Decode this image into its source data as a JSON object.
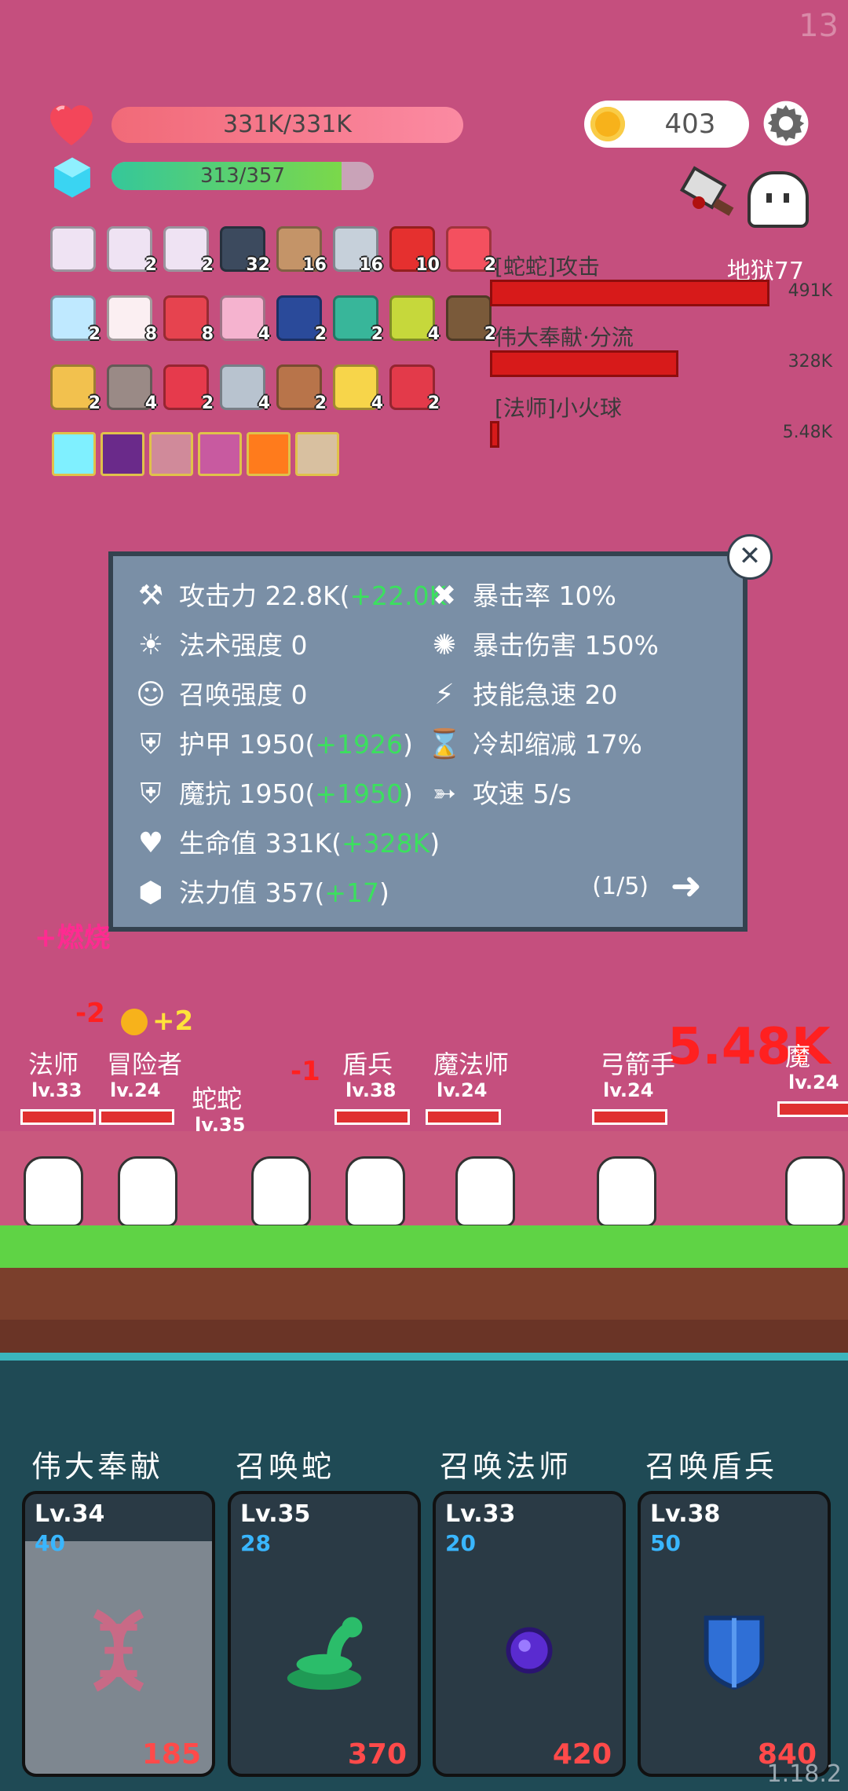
{
  "corner_number": "13",
  "hp": {
    "text": "331K/331K",
    "fraction": 1.0
  },
  "mana": {
    "text": "313/357",
    "fraction": 0.877
  },
  "coins": "403",
  "items": [
    {
      "icon": "scroll-icon",
      "count": ""
    },
    {
      "icon": "scroll-icon",
      "count": "2"
    },
    {
      "icon": "scroll-icon",
      "count": "2"
    },
    {
      "icon": "book-icon",
      "count": "32"
    },
    {
      "icon": "shield-round-icon",
      "count": "16"
    },
    {
      "icon": "sword-icon",
      "count": "16"
    },
    {
      "icon": "apple-icon",
      "count": "10"
    },
    {
      "icon": "heart-icon",
      "count": "2"
    },
    {
      "icon": "magnifier-icon",
      "count": "2"
    },
    {
      "icon": "flower-icon",
      "count": "8"
    },
    {
      "icon": "watermelon-icon",
      "count": "8"
    },
    {
      "icon": "icecream-icon",
      "count": "4"
    },
    {
      "icon": "bible-icon",
      "count": "2"
    },
    {
      "icon": "tent-icon",
      "count": "2"
    },
    {
      "icon": "durian-icon",
      "count": "4"
    },
    {
      "icon": "coconut-icon",
      "count": "2"
    },
    {
      "icon": "gift-icon",
      "count": "2"
    },
    {
      "icon": "tombstone-icon",
      "count": "4"
    },
    {
      "icon": "bookmark-icon",
      "count": "2"
    },
    {
      "icon": "mace-icon",
      "count": "4"
    },
    {
      "icon": "meat-icon",
      "count": "2"
    },
    {
      "icon": "cheese-icon",
      "count": "4"
    },
    {
      "icon": "strawberry-icon",
      "count": "2"
    }
  ],
  "skills": [
    "light-skill-icon",
    "demon-skill-icon",
    "blade-skill-icon",
    "pink-skill-icon",
    "fire-skill-icon",
    "shield-skill-icon"
  ],
  "damage_panel": {
    "difficulty": "地狱77",
    "rows": [
      {
        "name": "[蛇蛇]攻击",
        "value": "491K",
        "fraction": 1.0
      },
      {
        "name": "伟大奉献·分流",
        "value": "328K",
        "fraction": 0.668
      },
      {
        "name": "[法师]小火球",
        "value": "5.48K",
        "fraction": 0.011
      }
    ]
  },
  "stats": {
    "left": [
      {
        "icon": "axe-icon",
        "label": "攻击力",
        "value": "22.8K(",
        "bonus": "+22.0K",
        "tail": ""
      },
      {
        "icon": "sun-icon",
        "label": "法术强度",
        "value": "0",
        "bonus": "",
        "tail": ""
      },
      {
        "icon": "summon-icon",
        "label": "召唤强度",
        "value": "0",
        "bonus": "",
        "tail": ""
      },
      {
        "icon": "shield-icon",
        "label": "护甲",
        "value": "1950(",
        "bonus": "+1926",
        "tail": ")"
      },
      {
        "icon": "magic-shield-icon",
        "label": "魔抗",
        "value": "1950(",
        "bonus": "+1950",
        "tail": ")"
      },
      {
        "icon": "heart-icon",
        "label": "生命值",
        "value": "331K(",
        "bonus": "+328K",
        "tail": ")"
      },
      {
        "icon": "crystal-icon",
        "label": "法力值",
        "value": "357(",
        "bonus": "+17",
        "tail": ")"
      }
    ],
    "right": [
      {
        "icon": "crit-icon",
        "label": "暴击率",
        "value": "10%"
      },
      {
        "icon": "crit-damage-icon",
        "label": "暴击伤害",
        "value": "150%"
      },
      {
        "icon": "lightning-icon",
        "label": "技能急速",
        "value": "20"
      },
      {
        "icon": "hourglass-icon",
        "label": "冷却缩减",
        "value": "17%"
      },
      {
        "icon": "bow-icon",
        "label": "攻速",
        "value": "5/s"
      }
    ],
    "page": "(1/5)"
  },
  "battle": {
    "burn_text": "+燃烧",
    "big_damage": "5.48K",
    "coin_gain": "+2",
    "damage_pops": [
      "-2",
      "-1"
    ],
    "units": [
      {
        "name": "法师",
        "lv": "lv.33"
      },
      {
        "name": "冒险者",
        "lv": "lv.24"
      },
      {
        "name": "蛇蛇",
        "lv": "lv.35"
      },
      {
        "name": "盾兵",
        "lv": "lv.38"
      },
      {
        "name": "魔法师",
        "lv": "lv.24"
      },
      {
        "name": "弓箭手",
        "lv": "lv.24"
      },
      {
        "name": "魔",
        "lv": "lv.24"
      }
    ]
  },
  "cards": [
    {
      "title": "伟大奉献",
      "lv": "Lv.34",
      "cost": "40",
      "price": "185",
      "icon": "dna-icon"
    },
    {
      "title": "召唤蛇",
      "lv": "Lv.35",
      "cost": "28",
      "price": "370",
      "icon": "snake-icon"
    },
    {
      "title": "召唤法师",
      "lv": "Lv.33",
      "cost": "20",
      "price": "420",
      "icon": "orb-icon"
    },
    {
      "title": "召唤盾兵",
      "lv": "Lv.38",
      "cost": "50",
      "price": "840",
      "icon": "blue-shield-icon"
    }
  ],
  "version": "1.18.2"
}
